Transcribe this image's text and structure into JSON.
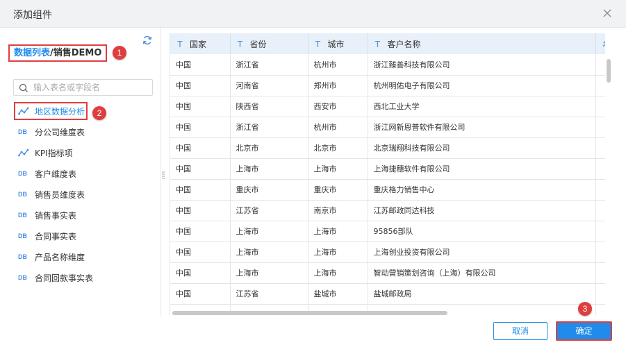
{
  "dialog": {
    "title": "添加组件"
  },
  "left_panel": {
    "breadcrumb_source": "数据列表",
    "breadcrumb_sep": "/",
    "breadcrumb_name": "销售DEMO",
    "search_placeholder": "输入表名或字段名",
    "items": [
      {
        "icon": "chart-line-icon",
        "label": "地区数据分析",
        "selected": true
      },
      {
        "icon": "db-icon",
        "label": "分公司维度表"
      },
      {
        "icon": "chart-line-icon",
        "label": "KPI指标项"
      },
      {
        "icon": "db-icon",
        "label": "客户维度表"
      },
      {
        "icon": "db-icon",
        "label": "销售员维度表"
      },
      {
        "icon": "db-icon",
        "label": "销售事实表"
      },
      {
        "icon": "db-icon",
        "label": "合同事实表"
      },
      {
        "icon": "db-icon",
        "label": "产品名称维度"
      },
      {
        "icon": "db-icon",
        "label": "合同回款事实表"
      }
    ],
    "db_icon_text": "DB"
  },
  "annotations": [
    "1",
    "2",
    "3"
  ],
  "grid": {
    "type_glyph": "T",
    "extra_glyph": "#",
    "columns": [
      "国家",
      "省份",
      "城市",
      "客户名称"
    ],
    "rows": [
      [
        "中国",
        "浙江省",
        "杭州市",
        "浙江臻善科技有限公司"
      ],
      [
        "中国",
        "河南省",
        "郑州市",
        "杭州明佑电子有限公司"
      ],
      [
        "中国",
        "陕西省",
        "西安市",
        "西北工业大学"
      ],
      [
        "中国",
        "浙江省",
        "杭州市",
        "浙江网新恩普软件有限公司"
      ],
      [
        "中国",
        "北京市",
        "北京市",
        "北京瑞翔科技有限公司"
      ],
      [
        "中国",
        "上海市",
        "上海市",
        "上海捷穗软件有限公司"
      ],
      [
        "中国",
        "重庆市",
        "重庆市",
        "重庆格力销售中心"
      ],
      [
        "中国",
        "江苏省",
        "南京市",
        "江苏邮政同达科技"
      ],
      [
        "中国",
        "上海市",
        "上海市",
        "95856部队"
      ],
      [
        "中国",
        "上海市",
        "上海市",
        "上海创业投资有限公司"
      ],
      [
        "中国",
        "上海市",
        "上海市",
        "智动营销策划咨询（上海）有限公司"
      ],
      [
        "中国",
        "江苏省",
        "盐城市",
        "盐城邮政局"
      ],
      [
        "",
        "",
        "",
        ""
      ]
    ]
  },
  "footer": {
    "cancel_label": "取消",
    "ok_label": "确定"
  },
  "colors": {
    "accent": "#1f8ceb",
    "highlight": "#e03e3e",
    "header_bg": "#e8f0f9"
  }
}
